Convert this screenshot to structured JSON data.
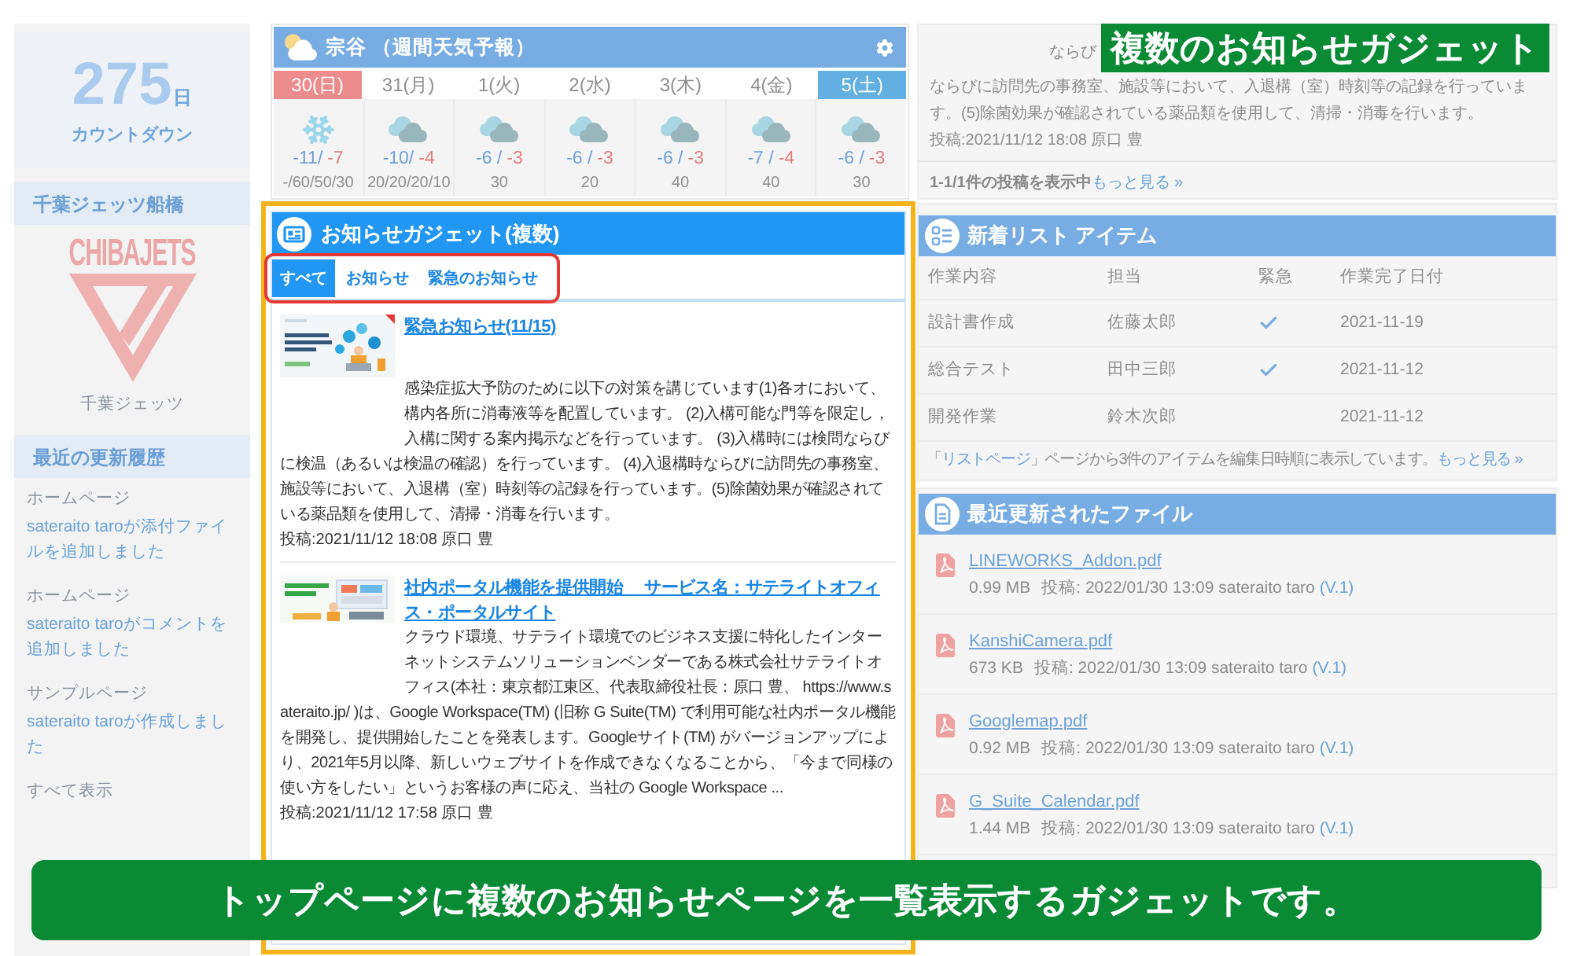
{
  "sidebar": {
    "countdown": {
      "number": "275",
      "unit": "日",
      "label": "カウントダウン"
    },
    "team": {
      "header": "千葉ジェッツ船橋",
      "logo_text": "CHIBAJETS",
      "caption": "千葉ジェッツ"
    },
    "updates": {
      "header": "最近の更新履歴",
      "items": [
        {
          "page": "ホームページ",
          "text": "sateraito taroが添付ファイルを追加しました"
        },
        {
          "page": "ホームページ",
          "text": "sateraito taroがコメントを追加しました"
        },
        {
          "page": "サンプルページ",
          "text": "sateraito taroが作成しました"
        }
      ],
      "show_all": "すべて表示"
    }
  },
  "weather": {
    "title": "宗谷 （週間天気予報）",
    "days": [
      {
        "label": "30(日)",
        "color": "#ec8c8c",
        "kind": "snow",
        "low": "-11/",
        "high": "-7",
        "precip": "-/60/50/30"
      },
      {
        "label": "31(月)",
        "kind": "cloudy",
        "low": "-10/",
        "high": "-4",
        "precip": "20/20/20/10"
      },
      {
        "label": "1(火)",
        "kind": "cloudy",
        "low": "-6 /",
        "high": "-3",
        "precip": "30"
      },
      {
        "label": "2(水)",
        "kind": "cloudy",
        "low": "-6 /",
        "high": "-3",
        "precip": "20"
      },
      {
        "label": "3(木)",
        "kind": "cloudy",
        "low": "-6 /",
        "high": "-3",
        "precip": "40"
      },
      {
        "label": "4(金)",
        "kind": "cloudy",
        "low": "-7 /",
        "high": "-4",
        "precip": "40"
      },
      {
        "label": "5(土)",
        "color": "#62afe2",
        "kind": "cloudy",
        "low": "-6 /",
        "high": "-3",
        "precip": "30"
      }
    ]
  },
  "callout": "複数のお知らせガジェット",
  "news_gadget": {
    "title": "お知らせガジェット(複数)",
    "tabs": [
      {
        "label": "すべて",
        "selected": true
      },
      {
        "label": "お知らせ",
        "selected": false
      },
      {
        "label": "緊急のお知らせ",
        "selected": false
      }
    ],
    "posts": [
      {
        "title": "緊急お知らせ(11/15)",
        "body": "感染症拡大予防のために以下の対策を講じています(1)各オにおいて、構内各所に消毒液等を配置しています。 (2)入構可能な門等を限定し，入構に関する案内掲示などを行っています。 (3)入構時には検問ならびに検温（あるいは検温の確認）を行っています。 (4)入退構時ならびに訪問先の事務室、施設等において、入退構（室）時刻等の記録を行っています。(5)除菌効果が確認されている薬品類を使用して、清掃・消毒を行います。",
        "meta": "投稿:2021/11/12 18:08 原口 豊"
      },
      {
        "title": "社内ポータル機能を提供開始　 サービス名：サテライトオフィス・ポータルサイト",
        "body": "クラウド環境、サテライト環境でのビジネス支援に特化したインターネットシステムソリューションベンダーである株式会社サテライトオフィス(本社：東京都江東区、代表取締役社長：原口 豊、 https://www.sateraito.jp/ )は、Google Workspace(TM) (旧称 G Suite(TM) で利用可能な社内ポータル機能を開発し、提供開始したことを発表します。Googleサイト(TM) がバージョンアップにより、2021年5月以降、新しいウェブサイトを作成できなくなることから、「今まで同様の使い方をしたい」というお客様の声に応え、当社の Google Workspace ...",
        "meta": "投稿:2021/11/12 17:58 原口 豊"
      }
    ]
  },
  "side_news": {
    "fragment": "ならび",
    "body": "ならびに訪問先の事務室、施設等において、入退構（室）時刻等の記録を行っています。(5)除菌効果が確認されている薬品類を使用して、清掃・消毒を行います。",
    "meta": "投稿:2021/11/12 18:08 原口 豊",
    "count": "1-1/1件の投稿を表示中",
    "more": "もっと見る »"
  },
  "list": {
    "title": "新着リスト アイテム",
    "columns": [
      "作業内容",
      "担当",
      "緊急",
      "作業完了日付"
    ],
    "rows": [
      {
        "task": "設計書作成",
        "assignee": "佐藤太郎",
        "urgent": true,
        "due": "2021-11-19"
      },
      {
        "task": "総合テスト",
        "assignee": "田中三郎",
        "urgent": true,
        "due": "2021-11-12"
      },
      {
        "task": "開発作業",
        "assignee": "鈴木次郎",
        "urgent": false,
        "due": "2021-11-12"
      }
    ],
    "footer": {
      "open": "「",
      "link": "リストページ",
      "rest": "」ページから3件のアイテムを編集日時順に表示しています。",
      "more": "もっと見る »"
    }
  },
  "files": {
    "title": "最近更新されたファイル",
    "items": [
      {
        "name": "LINEWORKS_Addon.pdf",
        "size": "0.99 MB",
        "posted": "投稿: 2022/01/30 13:09 sateraito taro",
        "version": "(V.1)"
      },
      {
        "name": "KanshiCamera.pdf",
        "size": "673 KB",
        "posted": "投稿: 2022/01/30 13:09 sateraito taro",
        "version": "(V.1)"
      },
      {
        "name": "Googlemap.pdf",
        "size": "0.92 MB",
        "posted": "投稿: 2022/01/30 13:09 sateraito taro",
        "version": "(V.1)"
      },
      {
        "name": "G_Suite_Calendar.pdf",
        "size": "1.44 MB",
        "posted": "投稿: 2022/01/30 13:09 sateraito taro",
        "version": "(V.1)"
      }
    ]
  },
  "banner": "トップページに複数のお知らせページを一覧表示するガジェットです。"
}
